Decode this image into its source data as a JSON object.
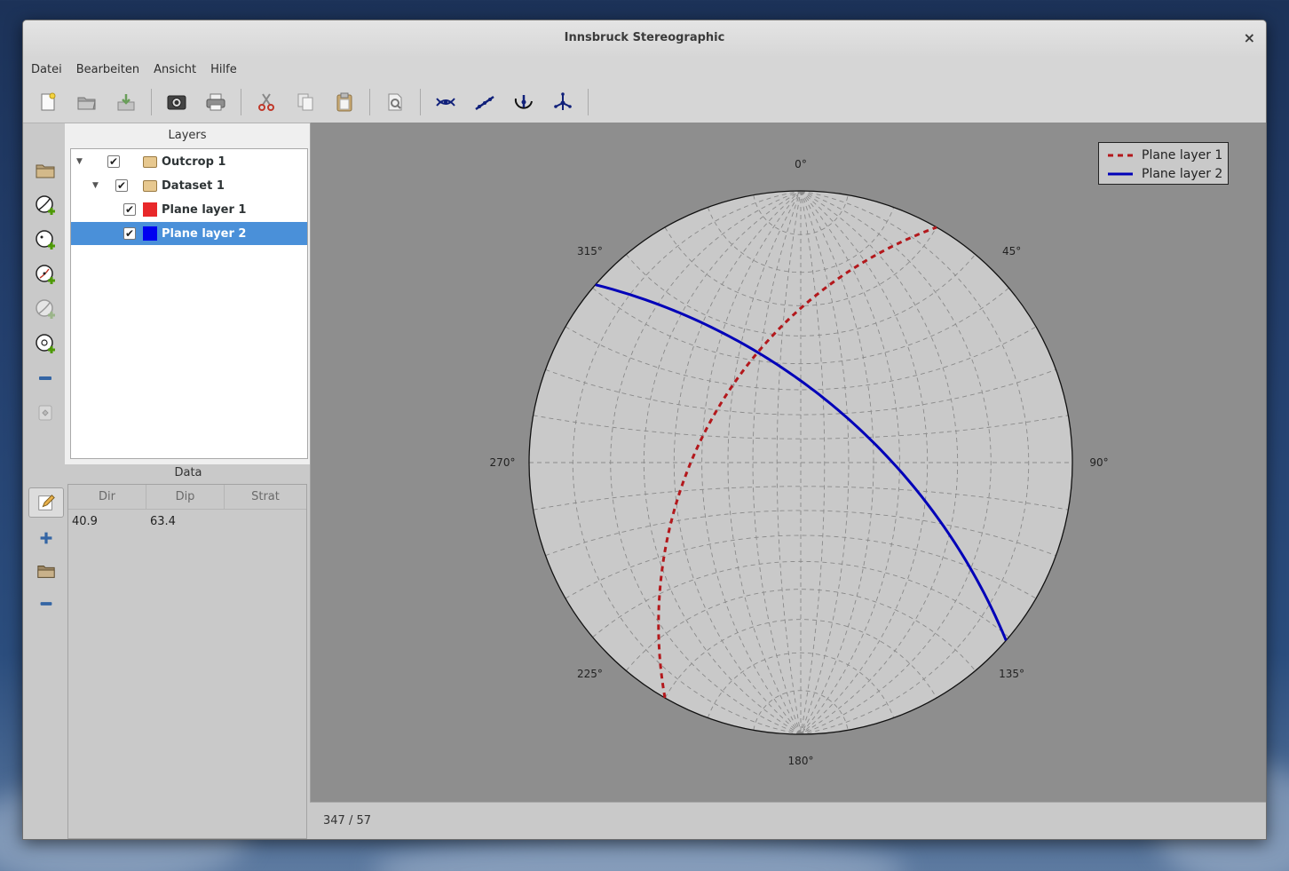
{
  "window": {
    "title": "Innsbruck Stereographic",
    "close_glyph": "×"
  },
  "menu": [
    "Datei",
    "Bearbeiten",
    "Ansicht",
    "Hilfe"
  ],
  "toolbar": {
    "icons": [
      "new-project-icon",
      "open-project-icon",
      "save-project-icon",
      "screenshot-icon",
      "print-icon",
      "cut-icon",
      "copy-icon",
      "paste-icon",
      "settings-icon",
      "plane-intersection-icon",
      "linear-fit-icon",
      "rotation-icon",
      "eigenvector-icon"
    ]
  },
  "layers_panel": {
    "title": "Layers",
    "items": [
      {
        "label": "Outcrop 1",
        "checked": true,
        "icon": "folder-icon",
        "level": 0
      },
      {
        "label": "Dataset 1",
        "checked": true,
        "icon": "folder-icon",
        "level": 1
      },
      {
        "label": "Plane layer 1",
        "checked": true,
        "color": "#e8282a",
        "level": 2
      },
      {
        "label": "Plane layer 2",
        "checked": true,
        "color": "#0000f0",
        "level": 2,
        "selected": true
      }
    ],
    "check_glyph": "✔",
    "expand_glyph": "▼"
  },
  "data_panel": {
    "title": "Data",
    "columns": [
      "Dir",
      "Dip",
      "Strat"
    ],
    "rows": [
      [
        "40.9",
        "63.4",
        ""
      ]
    ]
  },
  "plot": {
    "legend": [
      {
        "label": "Plane layer 1",
        "color": "#b3181c",
        "style": "dashed"
      },
      {
        "label": "Plane layer 2",
        "color": "#0000b8",
        "style": "solid"
      }
    ],
    "direction_labels": [
      "0°",
      "45°",
      "90°",
      "135°",
      "180°",
      "225°",
      "270°",
      "315°"
    ],
    "planes": [
      {
        "name": "Plane layer 1",
        "dip_direction": 300,
        "dip": 50
      },
      {
        "name": "Plane layer 2",
        "dip_direction": 40.9,
        "dip": 63.4
      }
    ]
  },
  "status": {
    "cursor_text": "347 / 57"
  }
}
